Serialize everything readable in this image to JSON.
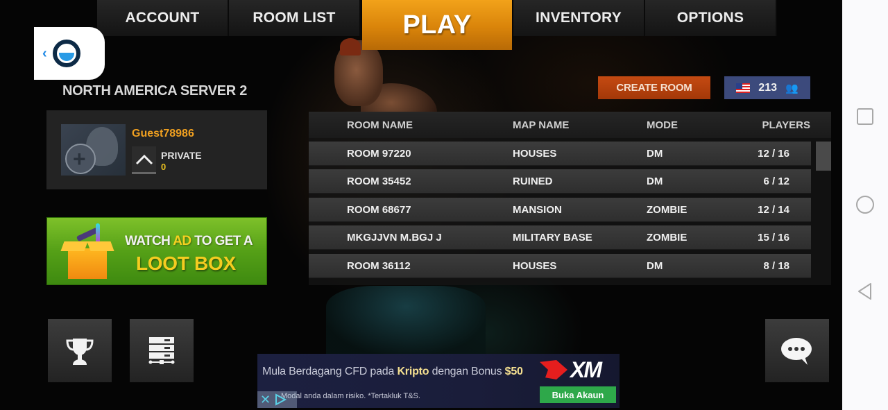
{
  "tabs": [
    {
      "label": "ACCOUNT",
      "active": false
    },
    {
      "label": "ROOM LIST",
      "active": false
    },
    {
      "label": "PLAY",
      "active": true
    },
    {
      "label": "INVENTORY",
      "active": false
    },
    {
      "label": "OPTIONS",
      "active": false
    }
  ],
  "server_name": "NORTH AMERICA SERVER 2",
  "profile": {
    "username": "Guest78986",
    "room_type_label": "PRIVATE",
    "room_type_value": "0"
  },
  "lootbox": {
    "line1_pre": "WATCH ",
    "line1_highlight": "AD",
    "line1_post": " TO GET A",
    "line2": "LOOT BOX"
  },
  "create_room_label": "CREATE ROOM",
  "online": {
    "region_flag": "us-flag",
    "count": "213",
    "icon": "people-icon"
  },
  "room_table": {
    "headers": {
      "name": "ROOM NAME",
      "map": "MAP NAME",
      "mode": "MODE",
      "players": "PLAYERS"
    },
    "rows": [
      {
        "name": "ROOM 97220",
        "map": "HOUSES",
        "mode": "DM",
        "players": "12 / 16"
      },
      {
        "name": "ROOM 35452",
        "map": "RUINED",
        "mode": "DM",
        "players": "6 / 12"
      },
      {
        "name": "ROOM 68677",
        "map": "MANSION",
        "mode": "ZOMBIE",
        "players": "12 / 14"
      },
      {
        "name": "MKGJJVN M.BGJ J",
        "map": "MILITARY BASE",
        "mode": "ZOMBIE",
        "players": "15 / 16"
      },
      {
        "name": "ROOM 36112",
        "map": "HOUSES",
        "mode": "DM",
        "players": "8 / 18"
      }
    ]
  },
  "bottom_buttons": {
    "leaderboard_icon": "trophy-icon",
    "server_icon": "server-icon",
    "chat_icon": "chat-bubble-icon"
  },
  "ad": {
    "text_pre": "Mula Berdagang CFD pada ",
    "text_hl1": "Kripto",
    "text_mid": " dengan Bonus ",
    "text_hl2": "$50",
    "disclaimer": "Modal anda dalam risiko. *Tertakluk T&S.",
    "brand": "XM",
    "cta": "Buka Akaun"
  },
  "colors": {
    "play_tab": "#e8920e",
    "create_room": "#b8420e",
    "online_badge": "#3c4a7c",
    "lootbox_green": "#5aa51a",
    "username": "#f0a020",
    "ad_cta": "#2ea84a"
  }
}
